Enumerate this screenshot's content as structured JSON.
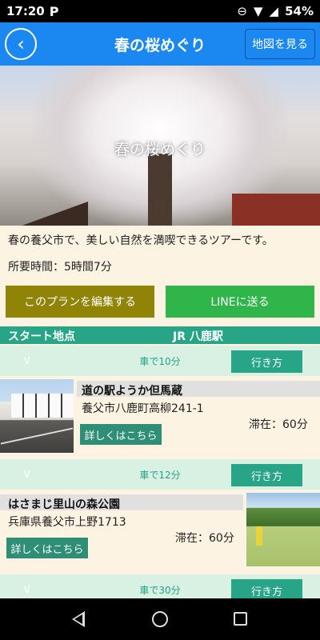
{
  "status": {
    "time": "17:20",
    "app_icon": "P",
    "battery": "54%"
  },
  "header": {
    "title": "春の桜めぐり",
    "map_button": "地図を見る",
    "back_icon": "back-arrow"
  },
  "hero": {
    "caption": "春の桜めぐり"
  },
  "plan": {
    "description": "春の養父市で、美しい自然を満喫できるツアーです。",
    "duration": "所要時間：5時間7分",
    "edit_button": "このプランを編集する",
    "line_button": "LINEに送る"
  },
  "start": {
    "label": "スタート地点",
    "station": "JR 八鹿駅"
  },
  "routes": [
    {
      "time": "車で10分",
      "button": "行き方"
    },
    {
      "time": "車で12分",
      "button": "行き方"
    },
    {
      "time": "車で30分",
      "button": "行き方"
    }
  ],
  "spots": [
    {
      "name": "道の駅ようか但馬蔵",
      "address": "養父市八鹿町高柳241-1",
      "stay": "滞在：60分",
      "more": "詳しくはこちら"
    },
    {
      "name": "はさまじ里山の森公園",
      "address": "兵庫県養父市上野1713",
      "stay": "滞在：60分",
      "more": "詳しくはこちら"
    }
  ],
  "colors": {
    "header": "#1b88f2",
    "accent": "#27a586",
    "edit": "#8f8405",
    "line": "#2fb54a"
  }
}
